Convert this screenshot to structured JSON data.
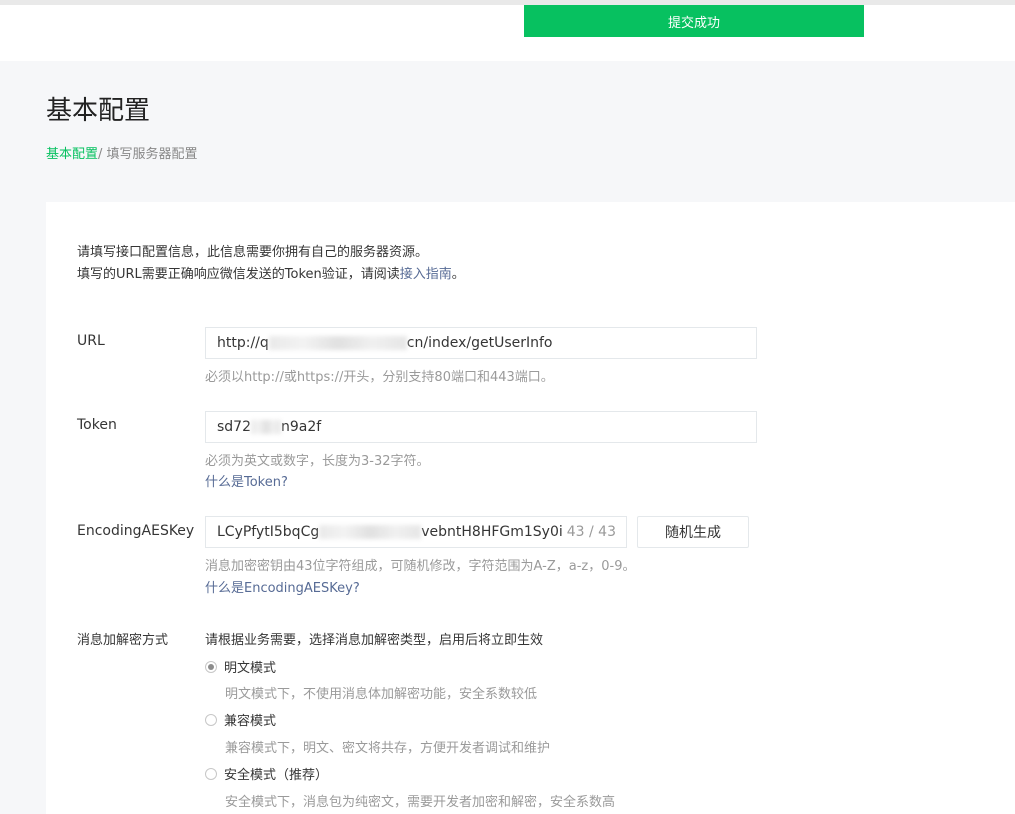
{
  "toast": {
    "text": "提交成功"
  },
  "page": {
    "title": "基本配置",
    "breadcrumb": {
      "root": "基本配置",
      "current": "/ 填写服务器配置"
    }
  },
  "intro": {
    "line1": "请填写接口配置信息，此信息需要你拥有自己的服务器资源。",
    "line2_prefix": "填写的URL需要正确响应微信发送的Token验证，请阅读",
    "line2_link": "接入指南",
    "line2_suffix": "。"
  },
  "fields": {
    "url": {
      "label": "URL",
      "value_start": "http://q",
      "value_end": "cn/index/getUserInfo",
      "hint": "必须以http://或https://开头，分别支持80端口和443端口。"
    },
    "token": {
      "label": "Token",
      "value_start": "sd72",
      "value_end": "n9a2f",
      "hint": "必须为英文或数字，长度为3-32字符。",
      "help": "什么是Token?"
    },
    "aes": {
      "label": "EncodingAESKey",
      "value_start": "LCyPfytI5bqCg",
      "value_end": "vebntH8HFGm1Sy0i",
      "counter": "43 / 43",
      "button": "随机生成",
      "hint": "消息加密密钥由43位字符组成，可随机修改，字符范围为A-Z，a-z，0-9。",
      "help": "什么是EncodingAESKey?"
    },
    "encryption": {
      "label": "消息加解密方式",
      "instruction": "请根据业务需要，选择消息加解密类型，启用后将立即生效",
      "options": [
        {
          "label": "明文模式",
          "desc": "明文模式下，不使用消息体加解密功能，安全系数较低",
          "checked": true
        },
        {
          "label": "兼容模式",
          "desc": "兼容模式下，明文、密文将共存，方便开发者调试和维护",
          "checked": false
        },
        {
          "label": "安全模式（推荐）",
          "desc": "安全模式下，消息包为纯密文，需要开发者加密和解密，安全系数高",
          "checked": false
        }
      ]
    }
  },
  "colors": {
    "accent": "#07c160",
    "link": "#576b95",
    "hint": "#9a9a9a"
  }
}
